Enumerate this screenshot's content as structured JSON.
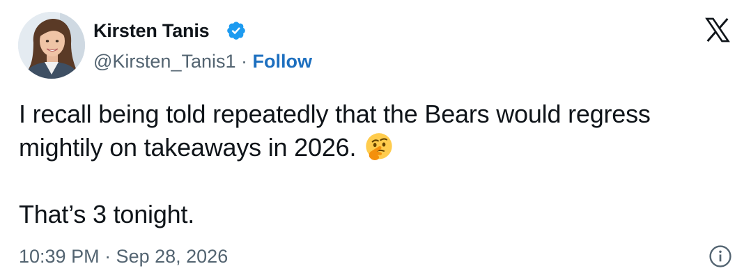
{
  "author": {
    "display_name": "Kirsten Tanis",
    "handle": "@Kirsten_Tanis1",
    "separator": " · ",
    "follow_label": "Follow",
    "verified": true
  },
  "tweet": {
    "line1": "I recall being told repeatedly that the Bears would regress",
    "line2": "mightily on takeaways in 2026.",
    "emoji": "thinking-face",
    "line3": "That’s 3 tonight.",
    "timestamp": "10:39 PM · Sep 28, 2026"
  },
  "icons": {
    "brand": "x-logo-icon",
    "verified": "verified-badge-icon",
    "info": "info-icon"
  },
  "colors": {
    "text": "#0f1419",
    "muted": "#536471",
    "link": "#1d6fbf",
    "verified": "#1d9bf0"
  }
}
